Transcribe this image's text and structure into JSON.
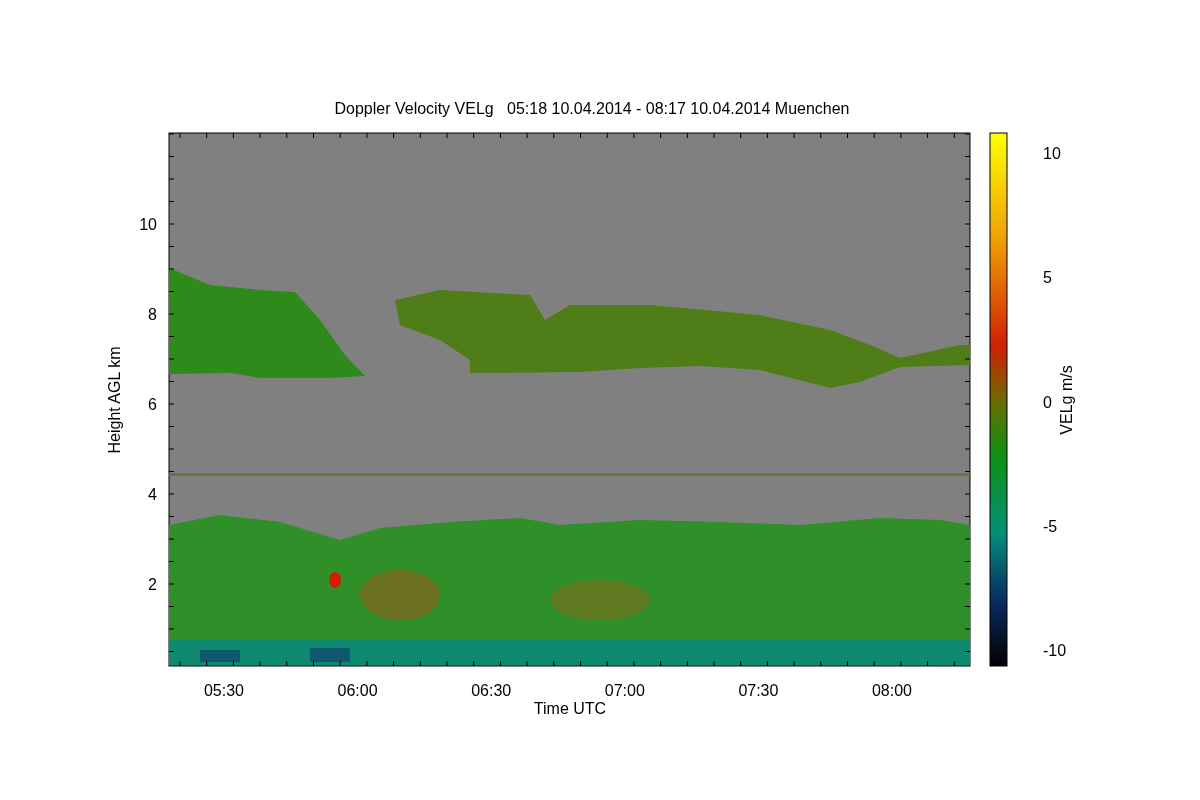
{
  "title": "Doppler Velocity VELg   05:18 10.04.2014 - 08:17 10.04.2014 Muenchen",
  "plot": {
    "xlabel": "Time UTC",
    "ylabel": "Height AGL km",
    "xticks": [
      "05:30",
      "06:00",
      "06:30",
      "07:00",
      "07:30",
      "08:00"
    ],
    "yticks": [
      "10",
      "8",
      "6",
      "4",
      "2"
    ]
  },
  "colorbar": {
    "label": "VELg m/s",
    "ticks": [
      "10",
      "5",
      "0",
      "-5",
      "-10"
    ]
  }
}
